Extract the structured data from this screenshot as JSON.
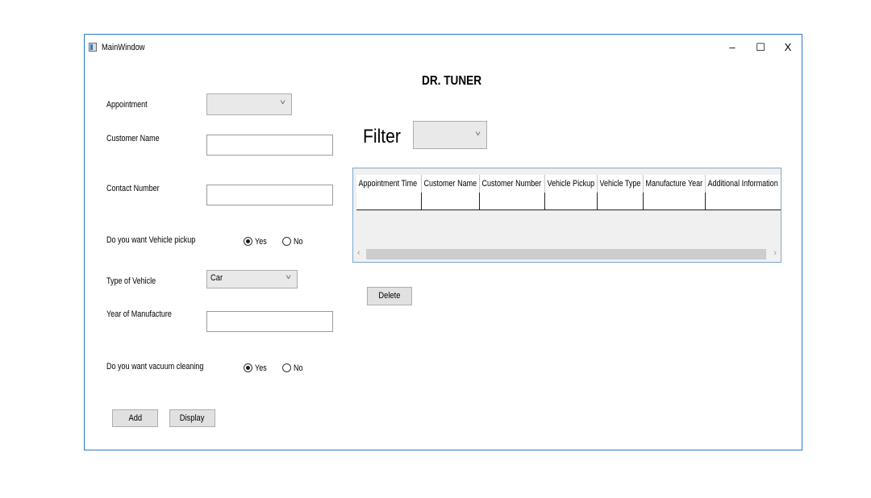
{
  "window": {
    "title": "MainWindow",
    "minimize_glyph": "–",
    "maximize_glyph": "☐",
    "close_glyph": "X"
  },
  "heading": "DR. TUNER",
  "form": {
    "appointment_label": "Appointment",
    "appointment_value": "",
    "customer_name_label": "Customer Name",
    "customer_name_value": "",
    "contact_number_label": "Contact Number",
    "contact_number_value": "",
    "vehicle_pickup_label": "Do you want Vehicle pickup",
    "vehicle_pickup_yes": "Yes",
    "vehicle_pickup_no": "No",
    "vehicle_pickup_selected": "Yes",
    "vehicle_type_label": "Type of Vehicle",
    "vehicle_type_value": "Car",
    "year_label": "Year of Manufacture",
    "year_value": "",
    "vacuum_label": "Do you want vacuum cleaning",
    "vacuum_yes": "Yes",
    "vacuum_no": "No",
    "vacuum_selected": "Yes",
    "add_button": "Add",
    "display_button": "Display"
  },
  "filter": {
    "label": "Filter",
    "value": ""
  },
  "table": {
    "columns": [
      "Appointment Time",
      "Customer Name",
      "Customer Number",
      "Vehicle Pickup",
      "Vehicle Type",
      "Manufacture Year",
      "Additional Information"
    ],
    "rows": [
      [
        "",
        "",
        "",
        "",
        "",
        "",
        ""
      ]
    ]
  },
  "delete_button": "Delete",
  "icons": {
    "chevron": "chevron-down-icon",
    "scroll_left": "‹",
    "scroll_right": "›"
  },
  "colors": {
    "window_border": "#2b79c9",
    "combo_bg": "#e9e9e9",
    "button_bg": "#e1e1e1"
  }
}
